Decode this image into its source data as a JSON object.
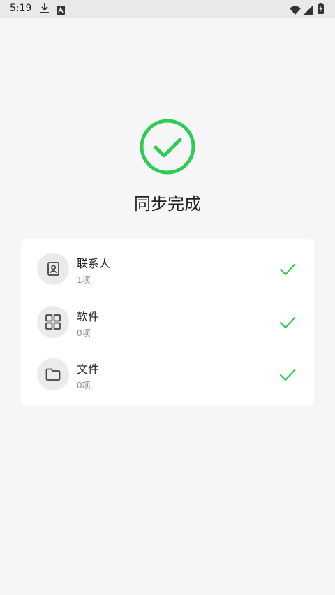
{
  "status_bar": {
    "time": "5:19",
    "icons": [
      "download-icon",
      "a-badge-icon",
      "wifi-icon",
      "signal-icon",
      "battery-icon"
    ]
  },
  "sync": {
    "title": "同步完成",
    "status_icon": "success-check-circle-icon",
    "accent_color": "#2ecc51"
  },
  "items": [
    {
      "label": "联系人",
      "count": "1项",
      "icon": "contacts-icon",
      "done_icon": "check-icon"
    },
    {
      "label": "软件",
      "count": "0项",
      "icon": "apps-grid-icon",
      "done_icon": "check-icon"
    },
    {
      "label": "文件",
      "count": "0项",
      "icon": "folder-icon",
      "done_icon": "check-icon"
    }
  ]
}
